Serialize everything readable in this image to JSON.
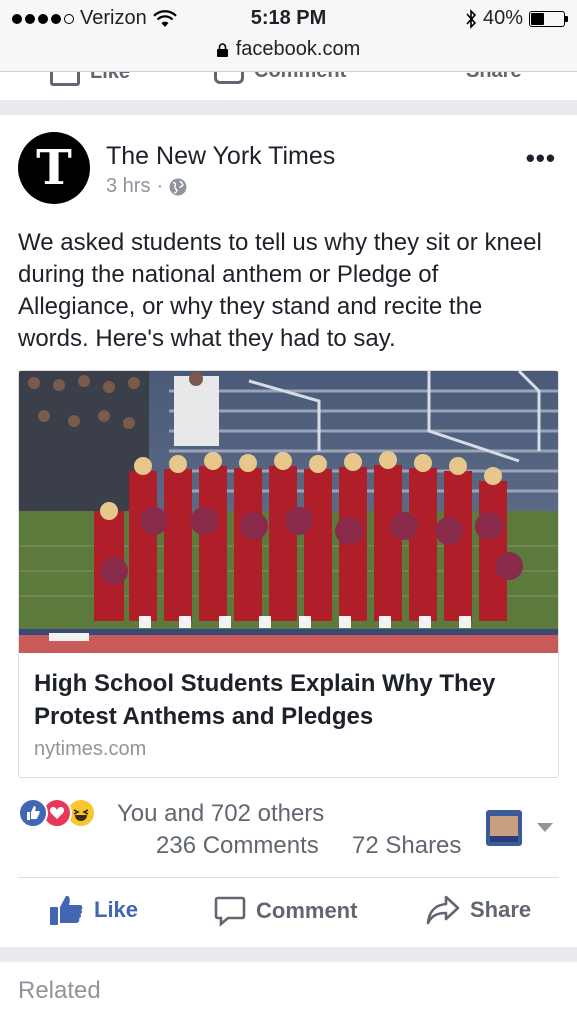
{
  "status_bar": {
    "carrier": "Verizon",
    "time": "5:18 PM",
    "battery": "40%",
    "battery_level": 0.4,
    "signal_bars": 4,
    "icons": [
      "wifi-icon",
      "bluetooth-icon",
      "battery-icon",
      "signal-icon"
    ]
  },
  "url_bar": {
    "url": "facebook.com",
    "icon": "lock-icon"
  },
  "prev_post_actions": {
    "like": "Like",
    "comment": "Comment",
    "share": "Share"
  },
  "post": {
    "page_name": "The New York Times",
    "avatar_letter": "T",
    "time": "3 hrs",
    "separator": "·",
    "privacy_icon": "globe-icon",
    "more_label": "•••",
    "text": "We asked students to tell us why they sit or kneel during the national anthem or Pledge of Allegiance, or why they stand and recite the words. Here's what they had to say.",
    "link": {
      "image": "cheerleaders-photo",
      "title": "High School Students Explain Why They Protest Anthems and Pledges",
      "domain": "nytimes.com"
    },
    "reactions": {
      "icons": [
        "like-reaction-icon",
        "love-reaction-icon",
        "haha-reaction-icon"
      ],
      "summary": "You and 702 others",
      "comments": "236 Comments",
      "shares": "72 Shares"
    },
    "actions": {
      "like": "Like",
      "comment": "Comment",
      "share": "Share"
    }
  },
  "related": {
    "label": "Related"
  },
  "colors": {
    "facebook_blue": "#4267b2",
    "love_red": "#e9375a",
    "haha_yellow": "#f7c72f",
    "secondary_text": "#90949c",
    "background": "#e9ebee"
  }
}
